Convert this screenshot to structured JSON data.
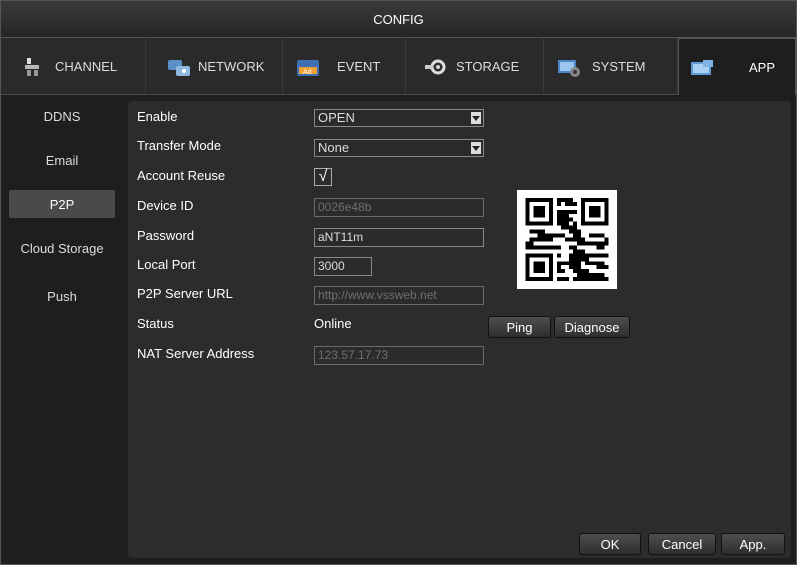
{
  "window": {
    "title": "CONFIG"
  },
  "tabs": [
    {
      "label": "CHANNEL",
      "icon": "channel-icon"
    },
    {
      "label": "NETWORK",
      "icon": "network-icon"
    },
    {
      "label": "EVENT",
      "icon": "event-icon"
    },
    {
      "label": "STORAGE",
      "icon": "storage-icon"
    },
    {
      "label": "SYSTEM",
      "icon": "system-icon"
    },
    {
      "label": "APP",
      "icon": "app-icon",
      "active": true
    }
  ],
  "sidebar": {
    "items": [
      {
        "label": "DDNS"
      },
      {
        "label": "Email"
      },
      {
        "label": "P2P",
        "active": true
      },
      {
        "label": "Cloud Storage"
      },
      {
        "label": "Push"
      }
    ]
  },
  "form": {
    "enable": {
      "label": "Enable",
      "value": "OPEN"
    },
    "transfer_mode": {
      "label": "Transfer Mode",
      "value": "None"
    },
    "account_reuse": {
      "label": "Account Reuse",
      "checked": true,
      "mark": "√"
    },
    "device_id": {
      "label": "Device ID",
      "value": "0026e48b"
    },
    "password": {
      "label": "Password",
      "value": "aNT11m"
    },
    "local_port": {
      "label": "Local Port",
      "value": "3000"
    },
    "p2p_server_url": {
      "label": "P2P Server URL",
      "value": "http://www.vssweb.net"
    },
    "status": {
      "label": "Status",
      "value": "Online"
    },
    "nat_server_address": {
      "label": "NAT Server Address",
      "value": "123.57.17.73"
    }
  },
  "buttons": {
    "ping": "Ping",
    "diagnose": "Diagnose",
    "ok": "OK",
    "cancel": "Cancel",
    "apply": "App."
  },
  "colors": {
    "background": "#1e1e1e",
    "panel": "#2c2c2c",
    "text": "#ffffff"
  }
}
